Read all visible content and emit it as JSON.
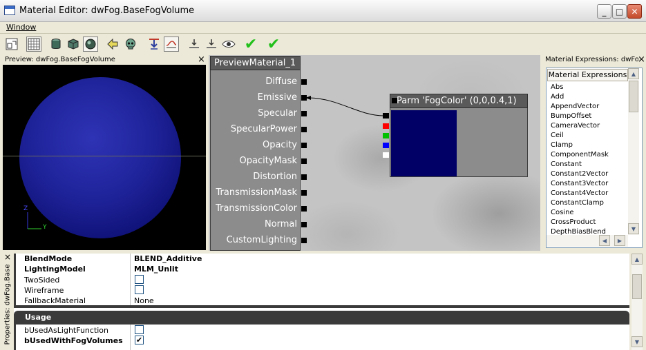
{
  "window": {
    "title": "Material Editor:  dwFog.BaseFogVolume"
  },
  "titlebar_buttons": {
    "minimize": "_",
    "maximize": "□",
    "close": "✕"
  },
  "menu": {
    "window": "Window"
  },
  "toolbar": {
    "icons": [
      "home-icon",
      "grid-icon",
      "cylinder-icon",
      "cube-icon",
      "sphere-icon",
      "back-arrow-icon",
      "skull-icon",
      "push-down-icon",
      "curve-icon",
      "pin-icon",
      "pin-icon",
      "eye-icon",
      "apply-check-icon",
      "apply-check-icon"
    ],
    "check": "✔"
  },
  "preview": {
    "title": "Preview: dwFog.BaseFogVolume",
    "close": "×",
    "axis_z": "Z",
    "axis_y": "Y"
  },
  "canvas": {
    "material_node": {
      "title": "PreviewMaterial_1",
      "inputs": [
        "Diffuse",
        "Emissive",
        "Specular",
        "SpecularPower",
        "Opacity",
        "OpacityMask",
        "Distortion",
        "TransmissionMask",
        "TransmissionColor",
        "Normal",
        "CustomLighting"
      ]
    },
    "param_node": {
      "title": "Parm 'FogColor' (0,0,0.4,1)",
      "swatch_color": "#000066",
      "pin_colors": [
        "#000000",
        "#ff0000",
        "#00c000",
        "#0000ff",
        "#ffffff"
      ]
    }
  },
  "expressions": {
    "title": "Material Expressions: dwFog.B",
    "close": "×",
    "header": "Material Expressions",
    "items": [
      "Abs",
      "Add",
      "AppendVector",
      "BumpOffset",
      "CameraVector",
      "Ceil",
      "Clamp",
      "ComponentMask",
      "Constant",
      "Constant2Vector",
      "Constant3Vector",
      "Constant4Vector",
      "ConstantClamp",
      "Cosine",
      "CrossProduct",
      "DepthBiasBlend"
    ]
  },
  "properties": {
    "side_tab": "Properties: dwFog.Base",
    "rows": [
      {
        "name": "BlendMode",
        "value": "BLEND_Additive",
        "bold": true
      },
      {
        "name": "LightingModel",
        "value": "MLM_Unlit",
        "bold": true
      },
      {
        "name": "TwoSided",
        "checked": false
      },
      {
        "name": "Wireframe",
        "checked": false
      },
      {
        "name": "FallbackMaterial",
        "value": "None"
      }
    ],
    "usage_section": "Usage",
    "usage_rows": [
      {
        "name": "bUsedAsLightFunction",
        "checked": false
      },
      {
        "name": "bUsedWithFogVolumes",
        "checked": true,
        "bold": true
      }
    ],
    "check_glyph": "✔",
    "close": "×"
  },
  "colors": {
    "accent": "#000066",
    "node_header": "#5a5a5a",
    "node_body": "#8c8c8c",
    "window_bg": "#ece9d8"
  }
}
